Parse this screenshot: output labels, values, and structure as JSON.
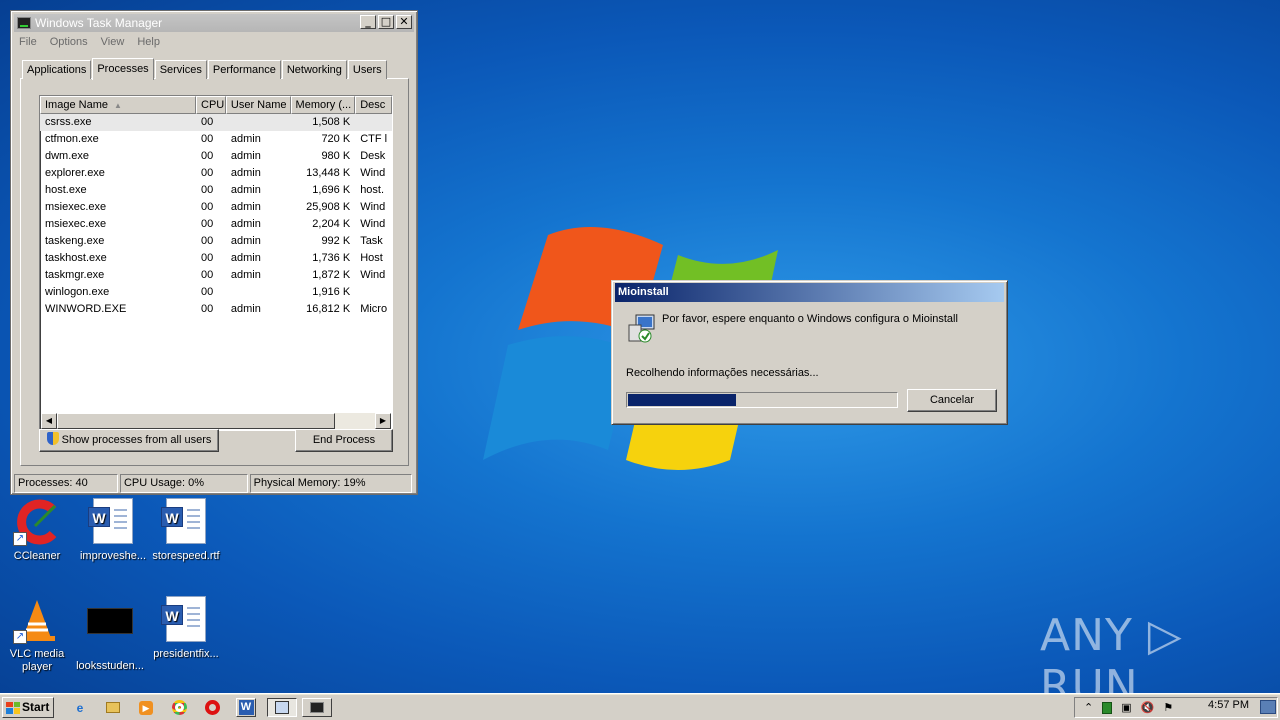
{
  "desktop": {
    "icons": [
      {
        "label": "CCleaner",
        "icon": "ccleaner-icon"
      },
      {
        "label": "improveshe...",
        "icon": "word-document-icon"
      },
      {
        "label": "storespeed.rtf",
        "icon": "word-document-icon"
      },
      {
        "label": "VLC media player",
        "icon": "vlc-icon"
      },
      {
        "label": "looksstuden...",
        "icon": "black-image-icon"
      },
      {
        "label": "presidentfix...",
        "icon": "word-document-icon"
      }
    ],
    "watermark": "ANY ▷ RUN"
  },
  "task_manager": {
    "title": "Windows Task Manager",
    "title_buttons": [
      "_",
      "□",
      "✕"
    ],
    "menu": [
      "File",
      "Options",
      "View",
      "Help"
    ],
    "tabs": [
      "Applications",
      "Processes",
      "Services",
      "Performance",
      "Networking",
      "Users"
    ],
    "active_tab": "Processes",
    "columns": [
      "Image Name",
      "CPU",
      "User Name",
      "Memory (...",
      "Desc"
    ],
    "rows": [
      [
        "csrss.exe",
        "00",
        "",
        "1,508 K",
        ""
      ],
      [
        "ctfmon.exe",
        "00",
        "admin",
        "720 K",
        "CTF l"
      ],
      [
        "dwm.exe",
        "00",
        "admin",
        "980 K",
        "Desk"
      ],
      [
        "explorer.exe",
        "00",
        "admin",
        "13,448 K",
        "Wind"
      ],
      [
        "host.exe",
        "00",
        "admin",
        "1,696 K",
        "host."
      ],
      [
        "msiexec.exe",
        "00",
        "admin",
        "25,908 K",
        "Wind"
      ],
      [
        "msiexec.exe",
        "00",
        "admin",
        "2,204 K",
        "Wind"
      ],
      [
        "taskeng.exe",
        "00",
        "admin",
        "992 K",
        "Task"
      ],
      [
        "taskhost.exe",
        "00",
        "admin",
        "1,736 K",
        "Host"
      ],
      [
        "taskmgr.exe",
        "00",
        "admin",
        "1,872 K",
        "Wind"
      ],
      [
        "winlogon.exe",
        "00",
        "",
        "1,916 K",
        ""
      ],
      [
        "WINWORD.EXE",
        "00",
        "admin",
        "16,812 K",
        "Micro"
      ]
    ],
    "show_all_button": "Show processes from all users",
    "end_process_button": "End Process",
    "status": {
      "processes": "Processes: 40",
      "cpu": "CPU Usage: 0%",
      "memory": "Physical Memory: 19%"
    }
  },
  "installer_dialog": {
    "title": "Mioinstall",
    "message": "Por favor, espere enquanto o Windows configura o Mioinstall",
    "status": "Recolhendo informações necessárias...",
    "progress": 0.4,
    "cancel_button": "Cancelar"
  },
  "taskbar": {
    "start_label": "Start",
    "clock": "4:57 PM",
    "colors": {
      "accent": "#0a246a",
      "flag_red": "#e8401c",
      "flag_green": "#6cbb2a",
      "flag_blue": "#1e7fd8",
      "flag_yellow": "#f7c51e"
    }
  }
}
